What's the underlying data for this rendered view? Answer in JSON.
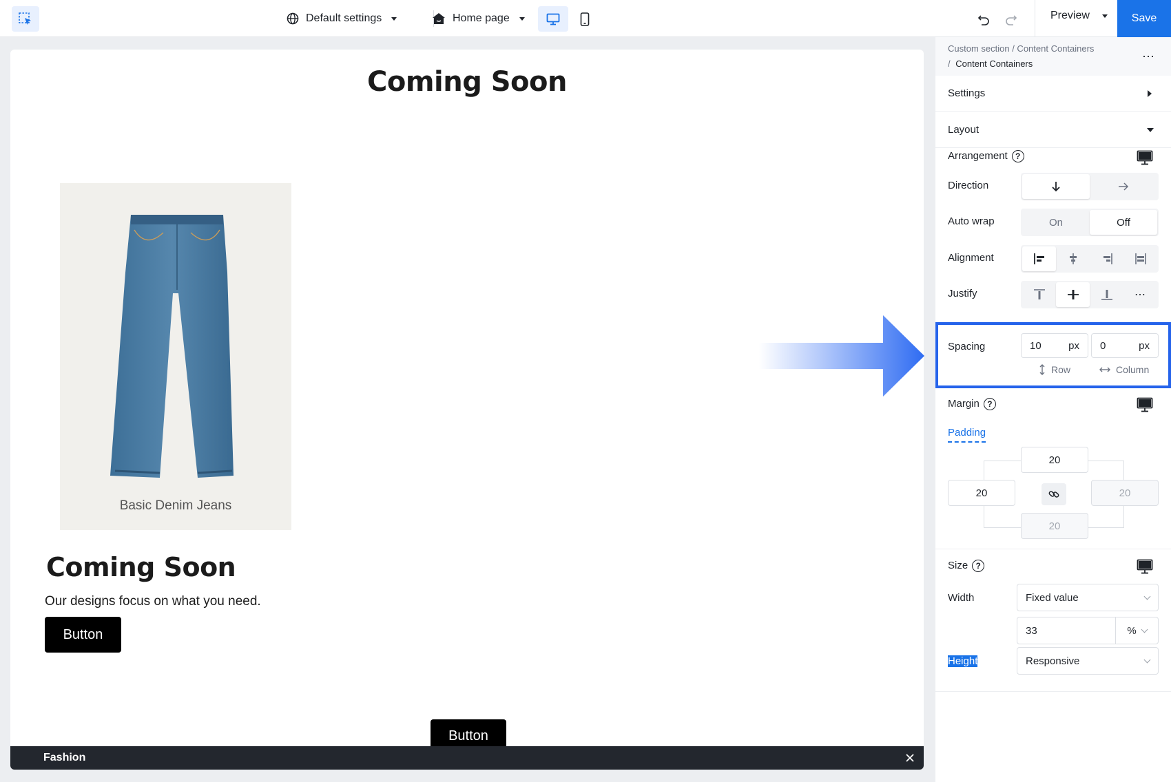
{
  "topbar": {
    "site_settings": "Default settings",
    "page": "Home page",
    "preview": "Preview",
    "save": "Save"
  },
  "canvas": {
    "title": "Coming Soon",
    "product_name": "Basic Denim Jeans",
    "card_title": "Coming Soon",
    "card_text": "Our designs focus on what you need.",
    "card_button": "Button",
    "bottom_button": "Button",
    "footer_label": "Fashion"
  },
  "panel": {
    "breadcrumb_line1": "Custom section / Content Containers",
    "breadcrumb_line2": "Content Containers",
    "breadcrumb_sep": "/",
    "settings": "Settings",
    "layout": "Layout",
    "arrangement": "Arrangement",
    "direction": "Direction",
    "auto_wrap": "Auto wrap",
    "auto_wrap_on": "On",
    "auto_wrap_off": "Off",
    "alignment": "Alignment",
    "justify": "Justify",
    "spacing": "Spacing",
    "spacing_row_value": "10",
    "spacing_column_value": "0",
    "unit_px": "px",
    "row": "Row",
    "column": "Column",
    "margin": "Margin",
    "padding": "Padding",
    "padding_top": "20",
    "padding_left": "20",
    "padding_right": "20",
    "padding_bottom": "20",
    "size": "Size",
    "width": "Width",
    "width_mode": "Fixed value",
    "width_value": "33",
    "width_unit": "%",
    "height": "Height",
    "height_mode": "Responsive",
    "help": "?"
  },
  "colors": {
    "accent": "#1a73e8",
    "highlight_border": "#2563eb",
    "footer_bar": "#23272e"
  }
}
